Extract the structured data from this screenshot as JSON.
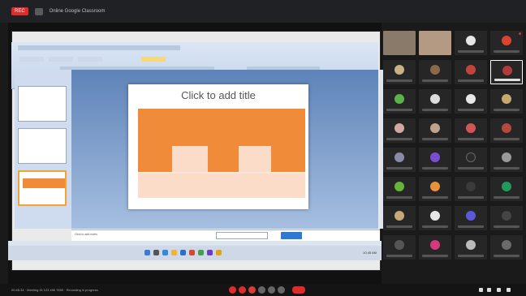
{
  "window": {
    "rec_label": "REC",
    "title": "Online Google Classroom"
  },
  "slide": {
    "title": "Click to add title"
  },
  "notes": {
    "label": "Click to add notes"
  },
  "bottom": {
    "meeting_info": "00:45:34 · Meeting ID 123 456 7890 · Recording in progress"
  },
  "taskbar": {
    "clock": "10:45 AM"
  },
  "colors": {
    "accent": "#f08b3a",
    "record": "#e02b2b",
    "end_call": "#e02b2b"
  },
  "icons": [
    "record-icon",
    "share-icon",
    "mic-icon",
    "video-icon",
    "hand-icon",
    "chat-icon",
    "people-icon",
    "end-call-icon"
  ]
}
